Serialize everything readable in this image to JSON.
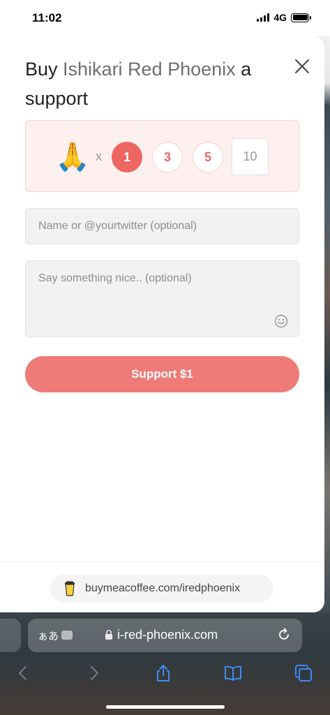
{
  "status_bar": {
    "time": "11:02",
    "network": "4G"
  },
  "modal": {
    "title_prefix": "Buy ",
    "creator_name": "Ishikari Red Phoenix",
    "title_suffix": " a support",
    "emoji": "🙏",
    "times_label": "x",
    "quantities": [
      {
        "label": "1",
        "selected": true
      },
      {
        "label": "3",
        "selected": false
      },
      {
        "label": "5",
        "selected": false
      }
    ],
    "custom_quantity_placeholder": "10",
    "name_placeholder": "Name or @yourtwitter (optional)",
    "message_placeholder": "Say something nice.. (optional)",
    "support_button_label": "Support $1",
    "footer_link": "buymeacoffee.com/iredphoenix",
    "accent_color": "#ee6661"
  },
  "safari": {
    "reader_label": "ぁあ",
    "url": "i-red-phoenix.com"
  }
}
